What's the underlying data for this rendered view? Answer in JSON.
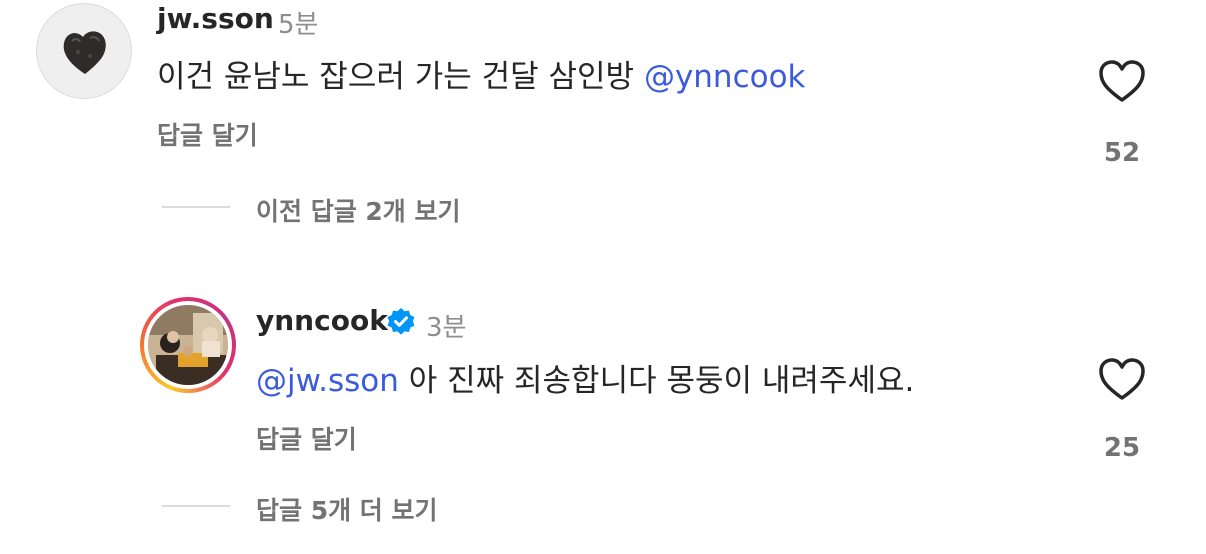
{
  "comments": [
    {
      "username": "jw.sson",
      "time": "5분",
      "text": "이건 윤남노 잡으러 가는 건달 삼인방 ",
      "mention": "@ynncook",
      "reply_label": "답글 달기",
      "likes": "52",
      "view_replies": "이전 답글 2개 보기"
    },
    {
      "username": "ynncook",
      "time": "3분",
      "mention": "@jw.sson",
      "text": " 아 진짜 죄송합니다 몽둥이 내려주세요.",
      "reply_label": "답글 달기",
      "likes": "25",
      "view_replies": "답글 5개 더 보기"
    }
  ],
  "colors": {
    "mention": "#3b5bdb",
    "verified": "#0095f6",
    "muted": "#737373"
  }
}
